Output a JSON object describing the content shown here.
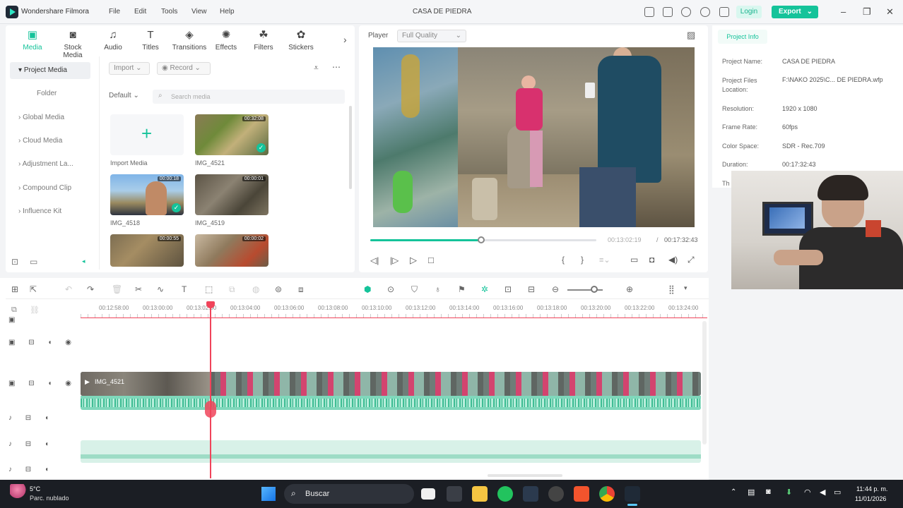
{
  "app": {
    "name": "Wondershare Filmora",
    "project_title": "CASA DE PIEDRA",
    "menu": [
      "File",
      "Edit",
      "Tools",
      "View",
      "Help"
    ],
    "login_label": "Login",
    "export_label": "Export"
  },
  "media_tabs": [
    "Media",
    "Stock Media",
    "Audio",
    "Titles",
    "Transitions",
    "Effects",
    "Filters",
    "Stickers"
  ],
  "sidebar": {
    "items": [
      "Project Media",
      "Folder",
      "Global Media",
      "Cloud Media",
      "Adjustment La...",
      "Compound Clip",
      "Influence Kit"
    ]
  },
  "media_toolbar": {
    "import_label": "Import",
    "record_label": "Record",
    "sort_label": "Default",
    "search_placeholder": "Search media"
  },
  "media_items": [
    {
      "label": "Import Media",
      "duration": ""
    },
    {
      "label": "IMG_4521",
      "duration": "00:32:08"
    },
    {
      "label": "IMG_4518",
      "duration": "00:00:18"
    },
    {
      "label": "IMG_4519",
      "duration": "00:00:01"
    },
    {
      "label": "",
      "duration": "00:00:55"
    },
    {
      "label": "",
      "duration": "00:00:02"
    }
  ],
  "player": {
    "label": "Player",
    "quality": "Full Quality",
    "current_time": "00:13:02:19",
    "separator": "/",
    "total_time": "00:17:32:43",
    "progress": 0.49
  },
  "project_info": {
    "tab": "Project Info",
    "fields": [
      {
        "label": "Project Name:",
        "value": "CASA DE PIEDRA"
      },
      {
        "label": "Project Files Location:",
        "value": "F:\\NAKO 2025\\C... DE PIEDRA.wfp"
      },
      {
        "label": "Resolution:",
        "value": "1920 x 1080"
      },
      {
        "label": "Frame Rate:",
        "value": "60fps"
      },
      {
        "label": "Color Space:",
        "value": "SDR - Rec.709"
      },
      {
        "label": "Duration:",
        "value": "00:17:32:43"
      }
    ],
    "partial_label": "Th"
  },
  "timeline": {
    "ruler": [
      "00:12:58:00",
      "00:13:00:00",
      "00:13:02:00",
      "00:13:04:00",
      "00:13:06:00",
      "00:13:08:00",
      "00:13:10:00",
      "00:13:12:00",
      "00:13:14:00",
      "00:13:16:00",
      "00:13:18:00",
      "00:13:20:00",
      "00:13:22:00",
      "00:13:24:00"
    ],
    "clip_label": "IMG_4521"
  },
  "taskbar": {
    "weather_temp": "5°C",
    "weather_desc": "Parc. nublado",
    "search_label": "Buscar",
    "time": "11:44 p. m.",
    "date": "11/01/2026"
  },
  "colors": {
    "accent": "#15c39a",
    "playhead": "#f0445a",
    "titlebar": "#f5f6f8",
    "taskbar": "#1b1e24"
  }
}
